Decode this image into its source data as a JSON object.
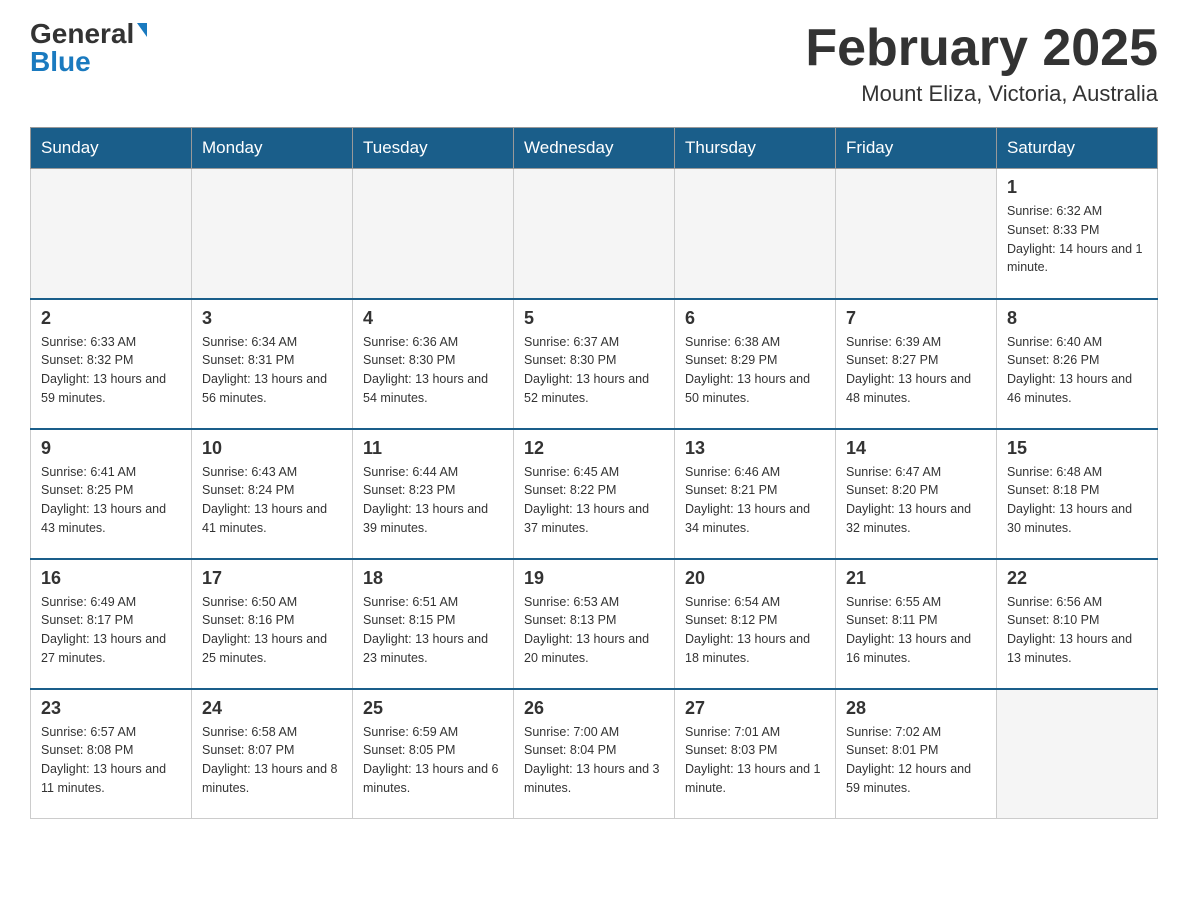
{
  "header": {
    "logo_general": "General",
    "logo_blue": "Blue",
    "title": "February 2025",
    "subtitle": "Mount Eliza, Victoria, Australia"
  },
  "days_of_week": [
    "Sunday",
    "Monday",
    "Tuesday",
    "Wednesday",
    "Thursday",
    "Friday",
    "Saturday"
  ],
  "weeks": [
    [
      {
        "num": "",
        "info": ""
      },
      {
        "num": "",
        "info": ""
      },
      {
        "num": "",
        "info": ""
      },
      {
        "num": "",
        "info": ""
      },
      {
        "num": "",
        "info": ""
      },
      {
        "num": "",
        "info": ""
      },
      {
        "num": "1",
        "info": "Sunrise: 6:32 AM\nSunset: 8:33 PM\nDaylight: 14 hours and 1 minute."
      }
    ],
    [
      {
        "num": "2",
        "info": "Sunrise: 6:33 AM\nSunset: 8:32 PM\nDaylight: 13 hours and 59 minutes."
      },
      {
        "num": "3",
        "info": "Sunrise: 6:34 AM\nSunset: 8:31 PM\nDaylight: 13 hours and 56 minutes."
      },
      {
        "num": "4",
        "info": "Sunrise: 6:36 AM\nSunset: 8:30 PM\nDaylight: 13 hours and 54 minutes."
      },
      {
        "num": "5",
        "info": "Sunrise: 6:37 AM\nSunset: 8:30 PM\nDaylight: 13 hours and 52 minutes."
      },
      {
        "num": "6",
        "info": "Sunrise: 6:38 AM\nSunset: 8:29 PM\nDaylight: 13 hours and 50 minutes."
      },
      {
        "num": "7",
        "info": "Sunrise: 6:39 AM\nSunset: 8:27 PM\nDaylight: 13 hours and 48 minutes."
      },
      {
        "num": "8",
        "info": "Sunrise: 6:40 AM\nSunset: 8:26 PM\nDaylight: 13 hours and 46 minutes."
      }
    ],
    [
      {
        "num": "9",
        "info": "Sunrise: 6:41 AM\nSunset: 8:25 PM\nDaylight: 13 hours and 43 minutes."
      },
      {
        "num": "10",
        "info": "Sunrise: 6:43 AM\nSunset: 8:24 PM\nDaylight: 13 hours and 41 minutes."
      },
      {
        "num": "11",
        "info": "Sunrise: 6:44 AM\nSunset: 8:23 PM\nDaylight: 13 hours and 39 minutes."
      },
      {
        "num": "12",
        "info": "Sunrise: 6:45 AM\nSunset: 8:22 PM\nDaylight: 13 hours and 37 minutes."
      },
      {
        "num": "13",
        "info": "Sunrise: 6:46 AM\nSunset: 8:21 PM\nDaylight: 13 hours and 34 minutes."
      },
      {
        "num": "14",
        "info": "Sunrise: 6:47 AM\nSunset: 8:20 PM\nDaylight: 13 hours and 32 minutes."
      },
      {
        "num": "15",
        "info": "Sunrise: 6:48 AM\nSunset: 8:18 PM\nDaylight: 13 hours and 30 minutes."
      }
    ],
    [
      {
        "num": "16",
        "info": "Sunrise: 6:49 AM\nSunset: 8:17 PM\nDaylight: 13 hours and 27 minutes."
      },
      {
        "num": "17",
        "info": "Sunrise: 6:50 AM\nSunset: 8:16 PM\nDaylight: 13 hours and 25 minutes."
      },
      {
        "num": "18",
        "info": "Sunrise: 6:51 AM\nSunset: 8:15 PM\nDaylight: 13 hours and 23 minutes."
      },
      {
        "num": "19",
        "info": "Sunrise: 6:53 AM\nSunset: 8:13 PM\nDaylight: 13 hours and 20 minutes."
      },
      {
        "num": "20",
        "info": "Sunrise: 6:54 AM\nSunset: 8:12 PM\nDaylight: 13 hours and 18 minutes."
      },
      {
        "num": "21",
        "info": "Sunrise: 6:55 AM\nSunset: 8:11 PM\nDaylight: 13 hours and 16 minutes."
      },
      {
        "num": "22",
        "info": "Sunrise: 6:56 AM\nSunset: 8:10 PM\nDaylight: 13 hours and 13 minutes."
      }
    ],
    [
      {
        "num": "23",
        "info": "Sunrise: 6:57 AM\nSunset: 8:08 PM\nDaylight: 13 hours and 11 minutes."
      },
      {
        "num": "24",
        "info": "Sunrise: 6:58 AM\nSunset: 8:07 PM\nDaylight: 13 hours and 8 minutes."
      },
      {
        "num": "25",
        "info": "Sunrise: 6:59 AM\nSunset: 8:05 PM\nDaylight: 13 hours and 6 minutes."
      },
      {
        "num": "26",
        "info": "Sunrise: 7:00 AM\nSunset: 8:04 PM\nDaylight: 13 hours and 3 minutes."
      },
      {
        "num": "27",
        "info": "Sunrise: 7:01 AM\nSunset: 8:03 PM\nDaylight: 13 hours and 1 minute."
      },
      {
        "num": "28",
        "info": "Sunrise: 7:02 AM\nSunset: 8:01 PM\nDaylight: 12 hours and 59 minutes."
      },
      {
        "num": "",
        "info": ""
      }
    ]
  ]
}
